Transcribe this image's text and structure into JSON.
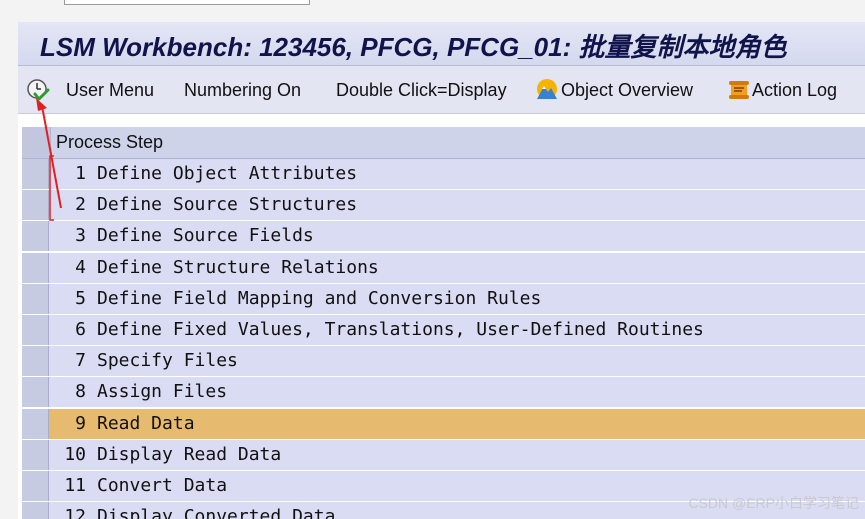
{
  "window": {
    "title": "LSM Workbench: 123456, PFCG, PFCG_01: 批量复制本地角色"
  },
  "toolbar": {
    "items": [
      {
        "icon": "execute-clock-icon",
        "label": ""
      },
      {
        "icon": "",
        "label": "User Menu"
      },
      {
        "icon": "",
        "label": "Numbering On"
      },
      {
        "icon": "",
        "label": "Double Click=Display"
      },
      {
        "icon": "object-overview-icon",
        "label": "Object Overview"
      },
      {
        "icon": "action-log-icon",
        "label": "Action Log"
      }
    ]
  },
  "grid": {
    "header": "Process Step",
    "selected_index": 8,
    "rows": [
      {
        "num": "1",
        "text": "Define Object Attributes"
      },
      {
        "num": "2",
        "text": "Define Source Structures"
      },
      {
        "num": "3",
        "text": "Define Source Fields"
      },
      {
        "num": "4",
        "text": "Define Structure Relations"
      },
      {
        "num": "5",
        "text": "Define Field Mapping and Conversion Rules"
      },
      {
        "num": "6",
        "text": "Define Fixed Values, Translations, User-Defined Routines"
      },
      {
        "num": "7",
        "text": "Specify Files"
      },
      {
        "num": "8",
        "text": "Assign Files"
      },
      {
        "num": "9",
        "text": "Read Data"
      },
      {
        "num": "10",
        "text": "Display Read Data"
      },
      {
        "num": "11",
        "text": "Convert Data"
      },
      {
        "num": "12",
        "text": "Display Converted Data"
      }
    ]
  },
  "watermark": "CSDN @ERP小白学习笔记",
  "colors": {
    "title_text": "#10144a",
    "row_bg": "#dadcf3",
    "row_selected": "#e7bb6f",
    "annotation": "#e02020"
  }
}
